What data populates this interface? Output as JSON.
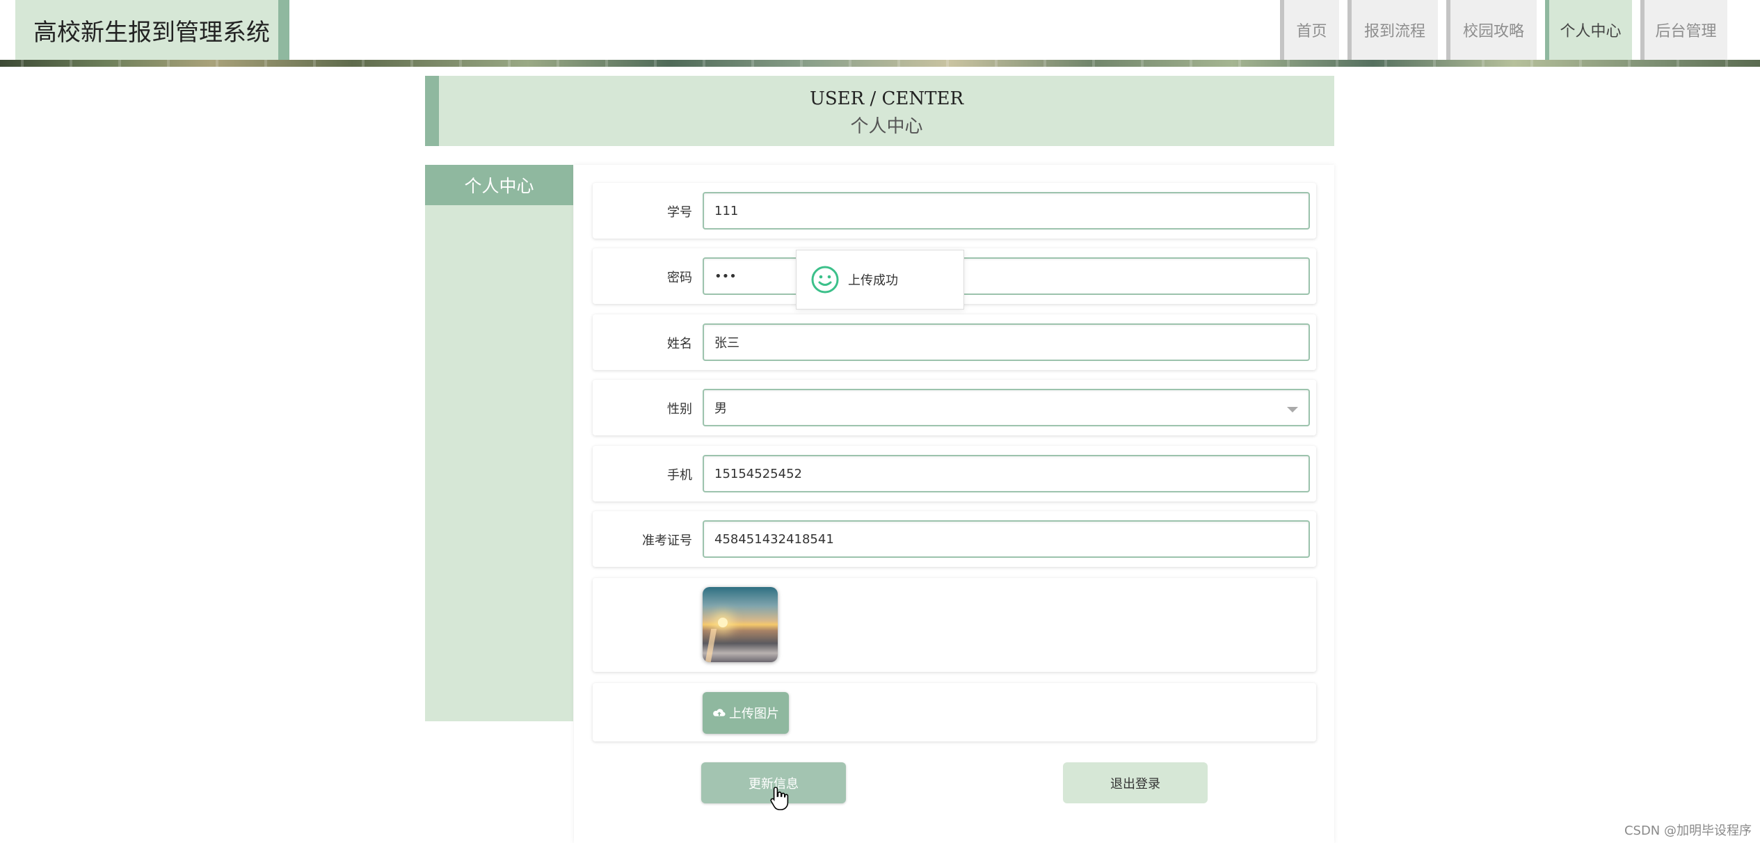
{
  "header": {
    "brand_title": "高校新生报到管理系统",
    "nav": [
      {
        "label": "首页",
        "active": false
      },
      {
        "label": "报到流程",
        "active": false
      },
      {
        "label": "校园攻略",
        "active": false
      },
      {
        "label": "个人中心",
        "active": true
      },
      {
        "label": "后台管理",
        "active": false
      }
    ]
  },
  "section": {
    "title_en": "USER / CENTER",
    "title_zh": "个人中心"
  },
  "sidebar": {
    "heading": "个人中心"
  },
  "form": {
    "student_id": {
      "label": "学号",
      "value": "111"
    },
    "password": {
      "label": "密码",
      "value": "•••"
    },
    "name": {
      "label": "姓名",
      "value": "张三"
    },
    "gender": {
      "label": "性别",
      "value": "男"
    },
    "phone": {
      "label": "手机",
      "value": "15154525452"
    },
    "exam_no": {
      "label": "准考证号",
      "value": "458451432418541"
    },
    "upload_label": "上传图片",
    "update_label": "更新信息",
    "logout_label": "退出登录"
  },
  "toast": {
    "message": "上传成功",
    "icon": "smile-icon"
  },
  "watermark": "CSDN @加明毕设程序",
  "colors": {
    "accent": "#8fb89f",
    "accent_light": "#d6e7d6",
    "field_border": "#9cc3ad"
  }
}
